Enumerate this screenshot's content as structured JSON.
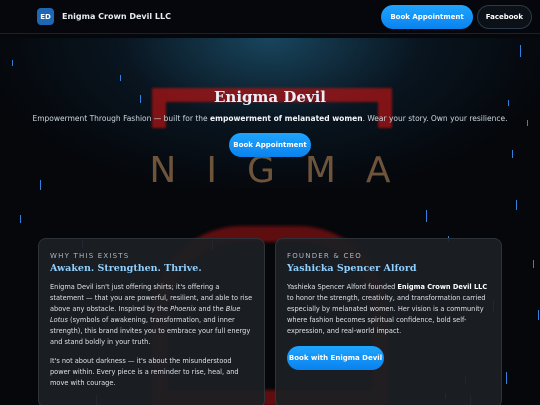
{
  "header": {
    "badge": "ED",
    "brand_name": "Enigma Crown Devil LLC",
    "nav": {
      "book_label": "Book Appointment",
      "facebook_label": "Facebook"
    }
  },
  "background": {
    "word": "NIGMA"
  },
  "hero": {
    "title": "Enigma Devil",
    "subtitle_start": "Empowerment Through Fashion — built for the ",
    "subtitle_bold": "empowerment of melanated women",
    "subtitle_end": ". Wear your story. Own your resilience.",
    "cta_label": "Book Appointment"
  },
  "why": {
    "eyebrow": "WHY THIS EXISTS",
    "title": "Awaken. Strengthen. Thrive.",
    "p1_a": "Enigma Devil isn't just offering shirts; it's offering a statement — that you are powerful, resilient, and able to rise above any obstacle. Inspired by the ",
    "p1_phoenix": "Phoenix",
    "p1_b": " and the ",
    "p1_lotus": "Blue Lotus",
    "p1_c": " (symbols of awakening, transformation, and inner strength), this brand invites you to embrace your full energy and stand boldly in your truth.",
    "p2": "It's not about darkness — it's about the misunderstood power within. Every piece is a reminder to rise, heal, and move with courage."
  },
  "founder": {
    "eyebrow": "FOUNDER & CEO",
    "title": "Yashicka Spencer Alford",
    "p_a": "Yashieka Spencer Alford founded ",
    "p_bold": "Enigma Crown Devil LLC",
    "p_b": " to honor the strength, creativity, and transformation carried especially by melanated women. Her vision is a community where fashion becomes spiritual confidence, bold self-expression, and real-world impact.",
    "cta_label": "Book with Enigma Devil"
  },
  "colors": {
    "accent": "#1ea5ff",
    "card_title": "#8fd0ff",
    "background": "#05070b"
  }
}
